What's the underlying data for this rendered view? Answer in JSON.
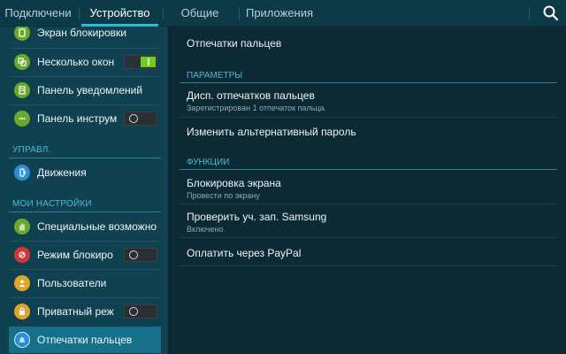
{
  "tabs": [
    {
      "label": "Подключени"
    },
    {
      "label": "Устройство"
    },
    {
      "label": "Общие"
    },
    {
      "label": "Приложения"
    }
  ],
  "sidebar": {
    "items": [
      {
        "label": "Экран блокировки",
        "icon": "lock-screen-icon",
        "color": "#6aa82b"
      },
      {
        "label": "Несколько окон",
        "icon": "multi-window-icon",
        "color": "#6aa82b",
        "toggle": "on"
      },
      {
        "label": "Панель уведомлений",
        "icon": "notification-panel-icon",
        "color": "#6aa82b"
      },
      {
        "label": "Панель инструм",
        "icon": "toolbox-icon",
        "color": "#6aa82b",
        "toggle": "off"
      },
      {
        "label": "Движения",
        "icon": "motion-icon",
        "color": "#2a8fd6"
      },
      {
        "label": "Специальные возможно",
        "icon": "accessibility-icon",
        "color": "#6aa82b"
      },
      {
        "label": "Режим блокиро",
        "icon": "blocking-mode-icon",
        "color": "#d0363a",
        "toggle": "off"
      },
      {
        "label": "Пользователи",
        "icon": "users-icon",
        "color": "#e0a42a"
      },
      {
        "label": "Приватный реж",
        "icon": "private-mode-icon",
        "color": "#e0a42a",
        "toggle": "off"
      },
      {
        "label": "Отпечатки пальцев",
        "icon": "fingerprint-icon",
        "color": "#2a8fd6"
      }
    ],
    "headers": {
      "control": "УПРАВЛ.",
      "personal": "МОИ НАСТРОЙКИ"
    }
  },
  "main": {
    "title": "Отпечатки пальцев",
    "sections": {
      "params": "ПАРАМЕТРЫ",
      "functions": "ФУНКЦИИ"
    },
    "items": {
      "fp_manager_title": "Дисп. отпечатков пальцев",
      "fp_manager_sub": "Зарегистрирован 1 отпечаток пальца.",
      "alt_password": "Изменить альтернативный пароль",
      "screen_lock_title": "Блокировка экрана",
      "screen_lock_sub": "Провести по экрану",
      "samsung_title": "Проверить уч. зап. Samsung",
      "samsung_sub": "Включено",
      "paypal": "Оплатить через PayPal"
    }
  },
  "colors": {
    "accent": "#2fb7dc",
    "active_item": "#15708a",
    "toggle_on": "#6ccf1f"
  }
}
